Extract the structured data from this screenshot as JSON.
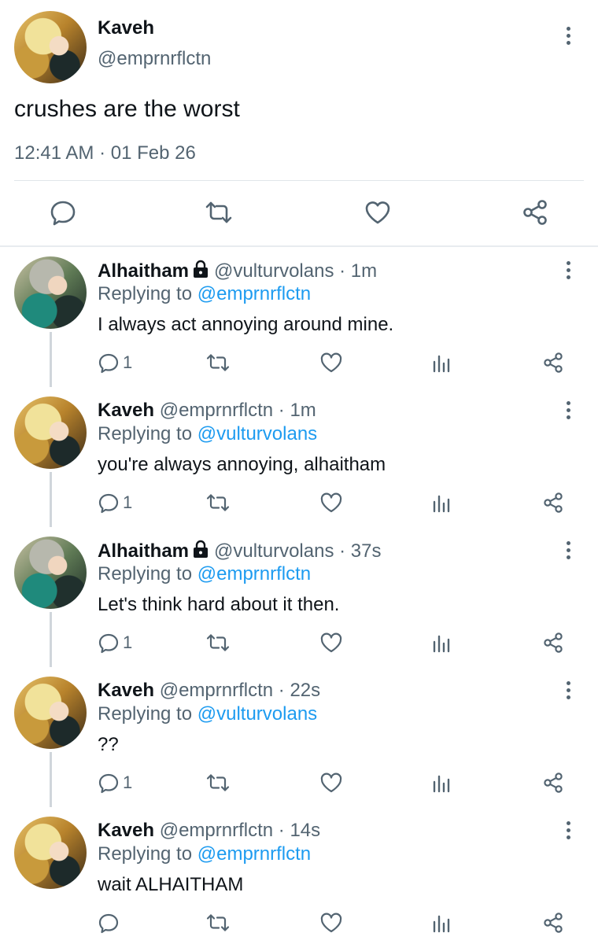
{
  "main_tweet": {
    "name": "Kaveh",
    "handle": "@emprnrflctn",
    "text": "crushes are the worst",
    "timestamp": "12:41 AM · 01 Feb 26",
    "actions": [
      "reply-icon",
      "retweet-icon",
      "like-icon",
      "share-icon"
    ]
  },
  "replies": [
    {
      "name": "Alhaitham",
      "locked": true,
      "handle": "@vulturvolans",
      "time": "· 1m",
      "replying_prefix": "Replying to ",
      "replying_to": "@emprnrflctn",
      "text": "I always act annoying around mine.",
      "reply_count": "1"
    },
    {
      "name": "Kaveh",
      "locked": false,
      "handle": "@emprnrflctn",
      "time": "· 1m",
      "replying_prefix": "Replying to ",
      "replying_to": "@vulturvolans",
      "text": "you're always annoying, alhaitham",
      "reply_count": "1"
    },
    {
      "name": "Alhaitham",
      "locked": true,
      "handle": "@vulturvolans",
      "time": "· 37s",
      "replying_prefix": "Replying to ",
      "replying_to": "@emprnrflctn",
      "text": "Let's think hard about it then.",
      "reply_count": "1"
    },
    {
      "name": "Kaveh",
      "locked": false,
      "handle": "@emprnrflctn",
      "time": "· 22s",
      "replying_prefix": "Replying to ",
      "replying_to": "@vulturvolans",
      "text": "??",
      "reply_count": "1"
    },
    {
      "name": "Kaveh",
      "locked": false,
      "handle": "@emprnrflctn",
      "time": "· 14s",
      "replying_prefix": "Replying to ",
      "replying_to": "@emprnrflctn",
      "text": "wait ALHAITHAM",
      "reply_count": ""
    }
  ],
  "colors": {
    "text": "#0f1419",
    "secondary": "#536471",
    "link": "#1d9bf0",
    "divider": "#e1e6ea"
  }
}
